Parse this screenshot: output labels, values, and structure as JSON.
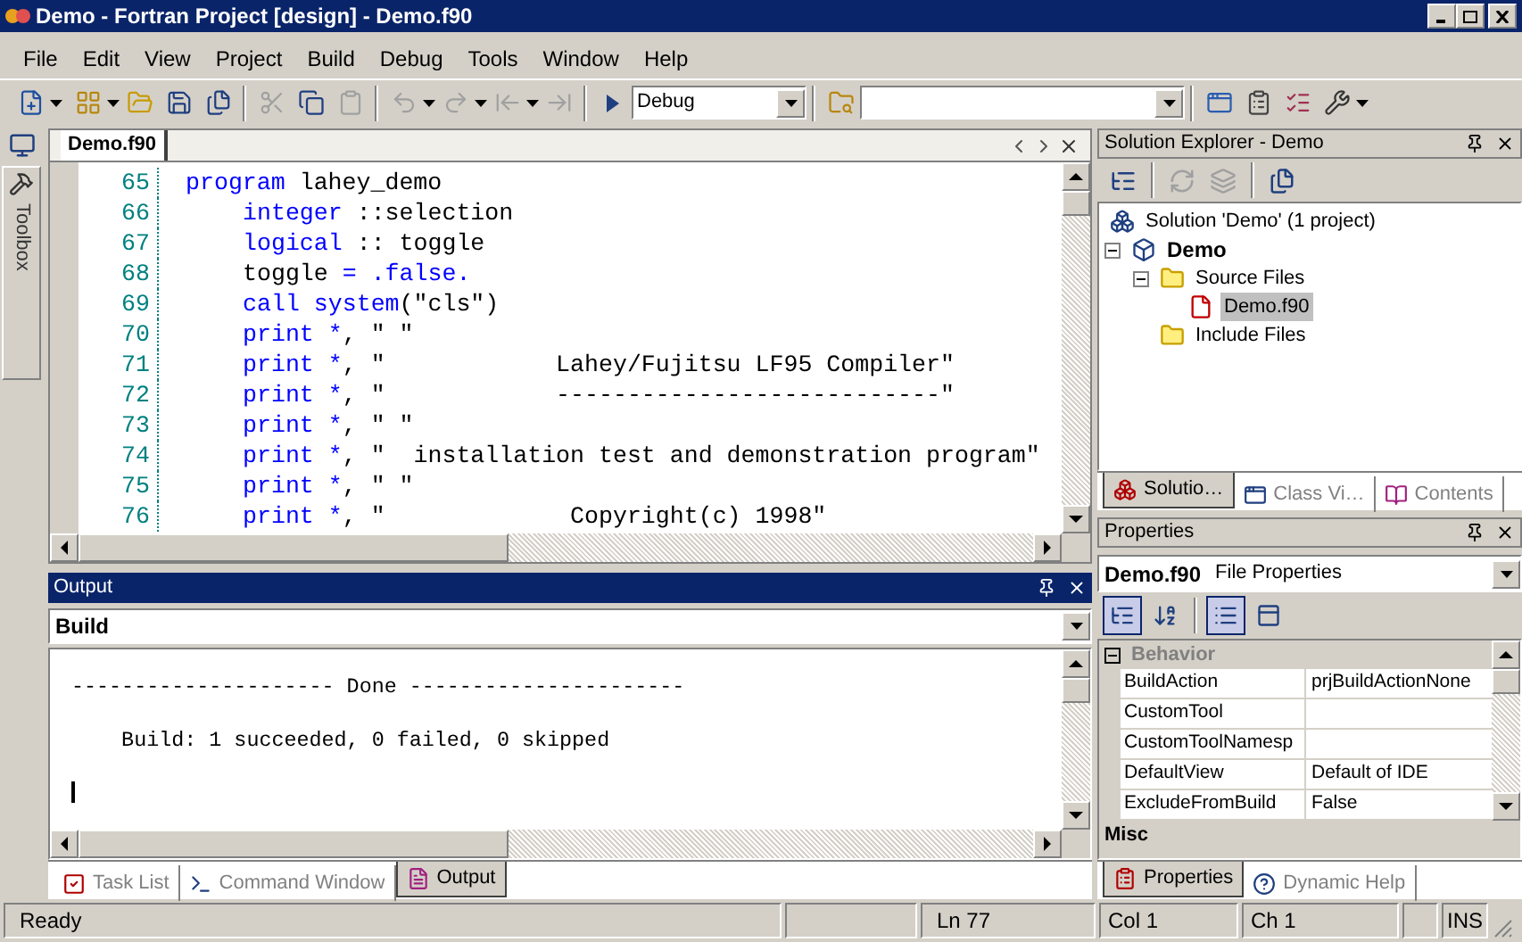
{
  "window": {
    "title": "Demo - Fortran Project [design] - Demo.f90"
  },
  "menu": [
    "File",
    "Edit",
    "View",
    "Project",
    "Build",
    "Debug",
    "Tools",
    "Window",
    "Help"
  ],
  "toolbar": {
    "buttons": [
      {
        "disabled": false
      },
      {
        "disabled": false
      },
      {
        "disabled": false
      },
      {
        "disabled": false
      },
      {
        "disabled": false
      },
      {
        "disabled": true
      },
      {
        "disabled": false
      },
      {
        "disabled": true
      },
      {
        "disabled": true
      },
      {
        "disabled": true
      },
      {
        "disabled": true
      },
      {
        "disabled": true
      },
      {
        "disabled": false
      },
      {
        "disabled": false
      },
      {
        "disabled": false
      },
      {
        "disabled": false
      },
      {
        "disabled": false
      },
      {
        "disabled": false
      }
    ],
    "configuration": "Debug"
  },
  "toolbox": {
    "label": "Toolbox"
  },
  "editor": {
    "tabs": [
      {
        "label": "Demo.f90",
        "selected": true
      }
    ],
    "lines": [
      {
        "number": "65",
        "indent": false,
        "tokens": [
          {
            "kind": "keyword",
            "text": "program"
          },
          {
            "kind": "plain",
            "text": " lahey_demo"
          }
        ]
      },
      {
        "number": "66",
        "indent": true,
        "tokens": [
          {
            "kind": "keyword",
            "text": "integer"
          },
          {
            "kind": "plain",
            "text": " ::selection"
          }
        ]
      },
      {
        "number": "67",
        "indent": true,
        "tokens": [
          {
            "kind": "keyword",
            "text": "logical"
          },
          {
            "kind": "plain",
            "text": " :: toggle"
          }
        ]
      },
      {
        "number": "68",
        "indent": true,
        "tokens": [
          {
            "kind": "plain",
            "text": "toggle "
          },
          {
            "kind": "keyword",
            "text": "= .false."
          }
        ]
      },
      {
        "number": "69",
        "indent": true,
        "tokens": [
          {
            "kind": "keyword",
            "text": "call system"
          },
          {
            "kind": "plain",
            "text": "(\"cls\")"
          }
        ]
      },
      {
        "number": "70",
        "indent": true,
        "tokens": [
          {
            "kind": "keyword",
            "text": "print *"
          },
          {
            "kind": "plain",
            "text": ", \" \""
          }
        ]
      },
      {
        "number": "71",
        "indent": true,
        "tokens": [
          {
            "kind": "keyword",
            "text": "print *"
          },
          {
            "kind": "plain",
            "text": ", \"            Lahey/Fujitsu LF95 Compiler\""
          }
        ]
      },
      {
        "number": "72",
        "indent": true,
        "tokens": [
          {
            "kind": "keyword",
            "text": "print *"
          },
          {
            "kind": "plain",
            "text": ", \"            ---------------------------\""
          }
        ]
      },
      {
        "number": "73",
        "indent": true,
        "tokens": [
          {
            "kind": "keyword",
            "text": "print *"
          },
          {
            "kind": "plain",
            "text": ", \" \""
          }
        ]
      },
      {
        "number": "74",
        "indent": true,
        "tokens": [
          {
            "kind": "keyword",
            "text": "print *"
          },
          {
            "kind": "plain",
            "text": ", \"  installation test and demonstration program\""
          }
        ]
      },
      {
        "number": "75",
        "indent": true,
        "tokens": [
          {
            "kind": "keyword",
            "text": "print *"
          },
          {
            "kind": "plain",
            "text": ", \" \""
          }
        ]
      },
      {
        "number": "76",
        "indent": true,
        "tokens": [
          {
            "kind": "keyword",
            "text": "print *"
          },
          {
            "kind": "plain",
            "text": ", \"             Copyright(c) 1998\""
          }
        ]
      }
    ]
  },
  "output": {
    "title": "Output",
    "source": "Build",
    "lines": [
      "--------------------- Done ----------------------",
      "    Build: 1 succeeded, 0 failed, 0 skipped"
    ],
    "tabs": [
      {
        "label": "Task List",
        "selected": false
      },
      {
        "label": "Command Window",
        "selected": false
      },
      {
        "label": "Output",
        "selected": true
      }
    ]
  },
  "solution_explorer": {
    "title": "Solution Explorer - Demo",
    "tree": [
      {
        "kind": "solution",
        "label": "Solution 'Demo' (1 project)",
        "selected": false,
        "children": [
          {
            "kind": "project",
            "label": "Demo",
            "selected": false,
            "expanded": true,
            "children": [
              {
                "kind": "folder",
                "label": "Source Files",
                "selected": false,
                "expanded": true,
                "children": [
                  {
                    "kind": "file",
                    "label": "Demo.f90",
                    "selected": true
                  }
                ]
              },
              {
                "kind": "folder",
                "label": "Include Files",
                "selected": false
              }
            ]
          }
        ]
      }
    ],
    "tabs": [
      {
        "label": "Solutio…",
        "selected": true
      },
      {
        "label": "Class Vi…",
        "selected": false
      },
      {
        "label": "Contents",
        "selected": false
      }
    ]
  },
  "properties": {
    "title": "Properties",
    "object": "Demo.f90",
    "object_type": "File Properties",
    "toolbar": [
      {
        "selected": true
      },
      {
        "selected": false
      },
      {
        "selected": true
      },
      {
        "selected": false
      }
    ],
    "categories": [
      {
        "label": "Behavior",
        "expanded": true,
        "rows": [
          {
            "name": "BuildAction",
            "value": "prjBuildActionNone"
          },
          {
            "name": "CustomTool"
          },
          {
            "name": "CustomToolNamesp"
          },
          {
            "name": "DefaultView",
            "value": "Default of IDE"
          },
          {
            "name": "ExcludeFromBuild",
            "value": "False"
          }
        ]
      },
      {
        "label": "Misc"
      }
    ],
    "tabs": [
      {
        "label": "Properties",
        "selected": true
      },
      {
        "label": "Dynamic Help",
        "selected": false
      }
    ]
  },
  "status_bar": {
    "message": "Ready",
    "line": "Ln 77",
    "column": "Col 1",
    "char": "Ch 1",
    "mode": "INS"
  }
}
